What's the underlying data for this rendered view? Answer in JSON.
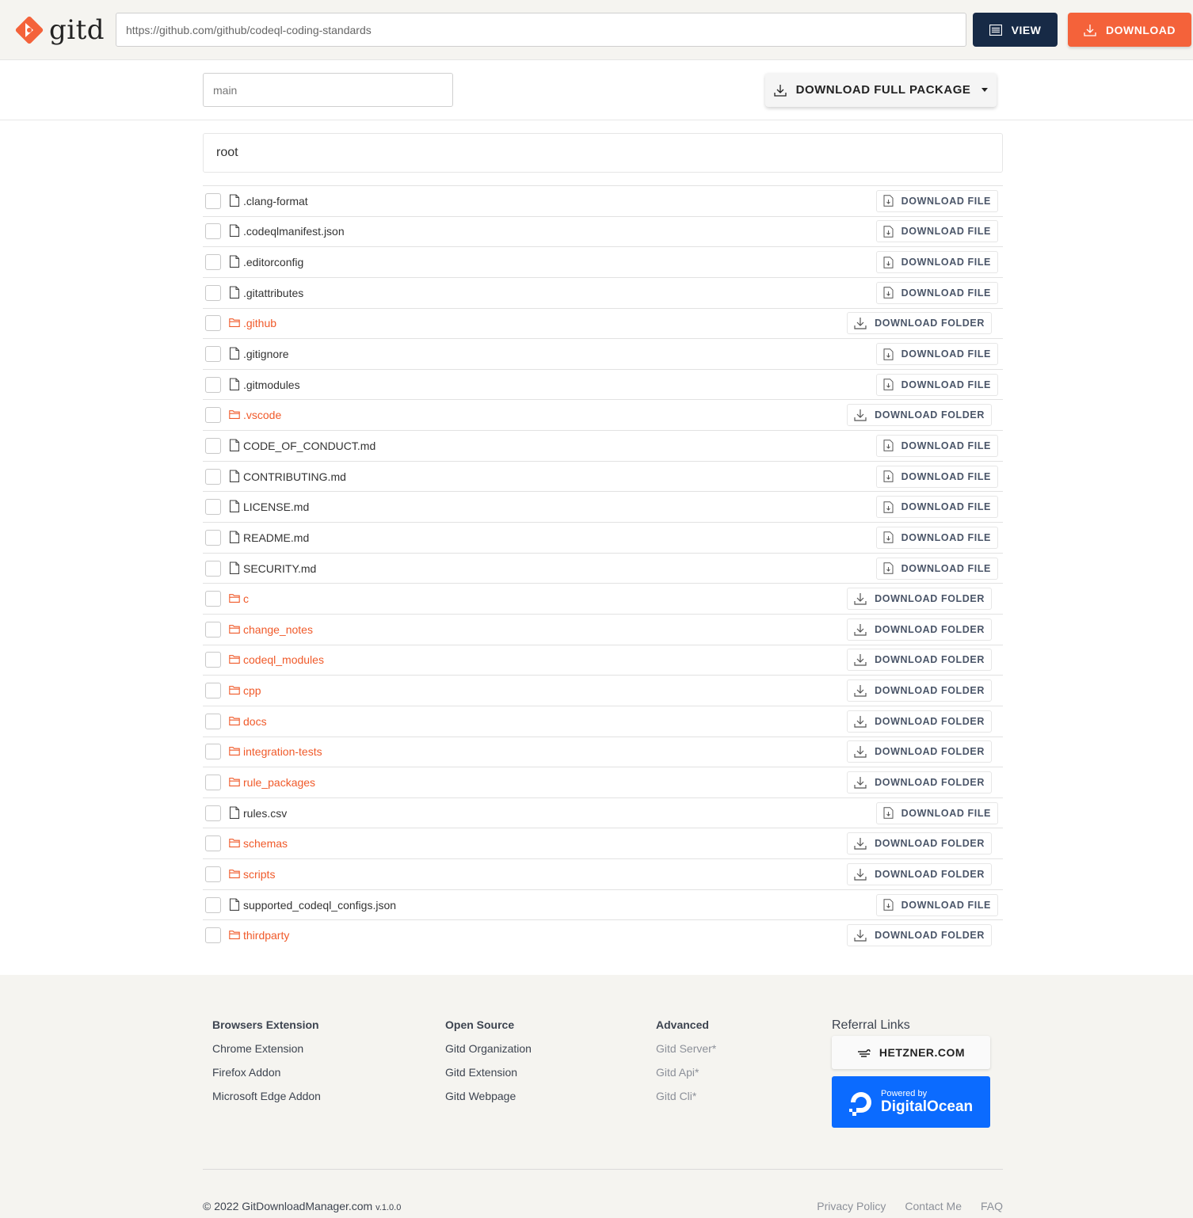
{
  "header": {
    "logo_text": "gitd",
    "url_value": "https://github.com/github/codeql-coding-standards",
    "view_label": "VIEW",
    "download_label": "DOWNLOAD",
    "accent": "#f4623a",
    "navy": "#172a46"
  },
  "toolbar": {
    "branch_placeholder": "main",
    "full_package_label": "DOWNLOAD FULL PACKAGE"
  },
  "breadcrumb": "root",
  "labels": {
    "file_btn": "DOWNLOAD FILE",
    "folder_btn": "DOWNLOAD FOLDER"
  },
  "entries": [
    {
      "name": ".clang-format",
      "type": "file"
    },
    {
      "name": ".codeqlmanifest.json",
      "type": "file"
    },
    {
      "name": ".editorconfig",
      "type": "file"
    },
    {
      "name": ".gitattributes",
      "type": "file"
    },
    {
      "name": ".github",
      "type": "folder"
    },
    {
      "name": ".gitignore",
      "type": "file"
    },
    {
      "name": ".gitmodules",
      "type": "file"
    },
    {
      "name": ".vscode",
      "type": "folder"
    },
    {
      "name": "CODE_OF_CONDUCT.md",
      "type": "file"
    },
    {
      "name": "CONTRIBUTING.md",
      "type": "file"
    },
    {
      "name": "LICENSE.md",
      "type": "file"
    },
    {
      "name": "README.md",
      "type": "file"
    },
    {
      "name": "SECURITY.md",
      "type": "file"
    },
    {
      "name": "c",
      "type": "folder"
    },
    {
      "name": "change_notes",
      "type": "folder"
    },
    {
      "name": "codeql_modules",
      "type": "folder"
    },
    {
      "name": "cpp",
      "type": "folder"
    },
    {
      "name": "docs",
      "type": "folder"
    },
    {
      "name": "integration-tests",
      "type": "folder"
    },
    {
      "name": "rule_packages",
      "type": "folder"
    },
    {
      "name": "rules.csv",
      "type": "file"
    },
    {
      "name": "schemas",
      "type": "folder"
    },
    {
      "name": "scripts",
      "type": "folder"
    },
    {
      "name": "supported_codeql_configs.json",
      "type": "file"
    },
    {
      "name": "thirdparty",
      "type": "folder"
    }
  ],
  "footer": {
    "browsers": {
      "title": "Browsers Extension",
      "links": [
        "Chrome Extension",
        "Firefox Addon",
        "Microsoft Edge Addon"
      ]
    },
    "open_source": {
      "title": "Open Source",
      "links": [
        "Gitd Organization",
        "Gitd Extension",
        "Gitd Webpage"
      ]
    },
    "advanced": {
      "title": "Advanced",
      "links": [
        "Gitd Server*",
        "Gitd Api*",
        "Gitd Cli*"
      ]
    },
    "referral": {
      "title": "Referral Links",
      "hetzner": "HETZNER.COM",
      "do_small": "Powered by",
      "do_big": "DigitalOcean"
    },
    "copyright": "© 2022 GitDownloadManager.com",
    "version": "v.1.0.0",
    "bottom_links": [
      "Privacy Policy",
      "Contact Me",
      "FAQ"
    ]
  }
}
